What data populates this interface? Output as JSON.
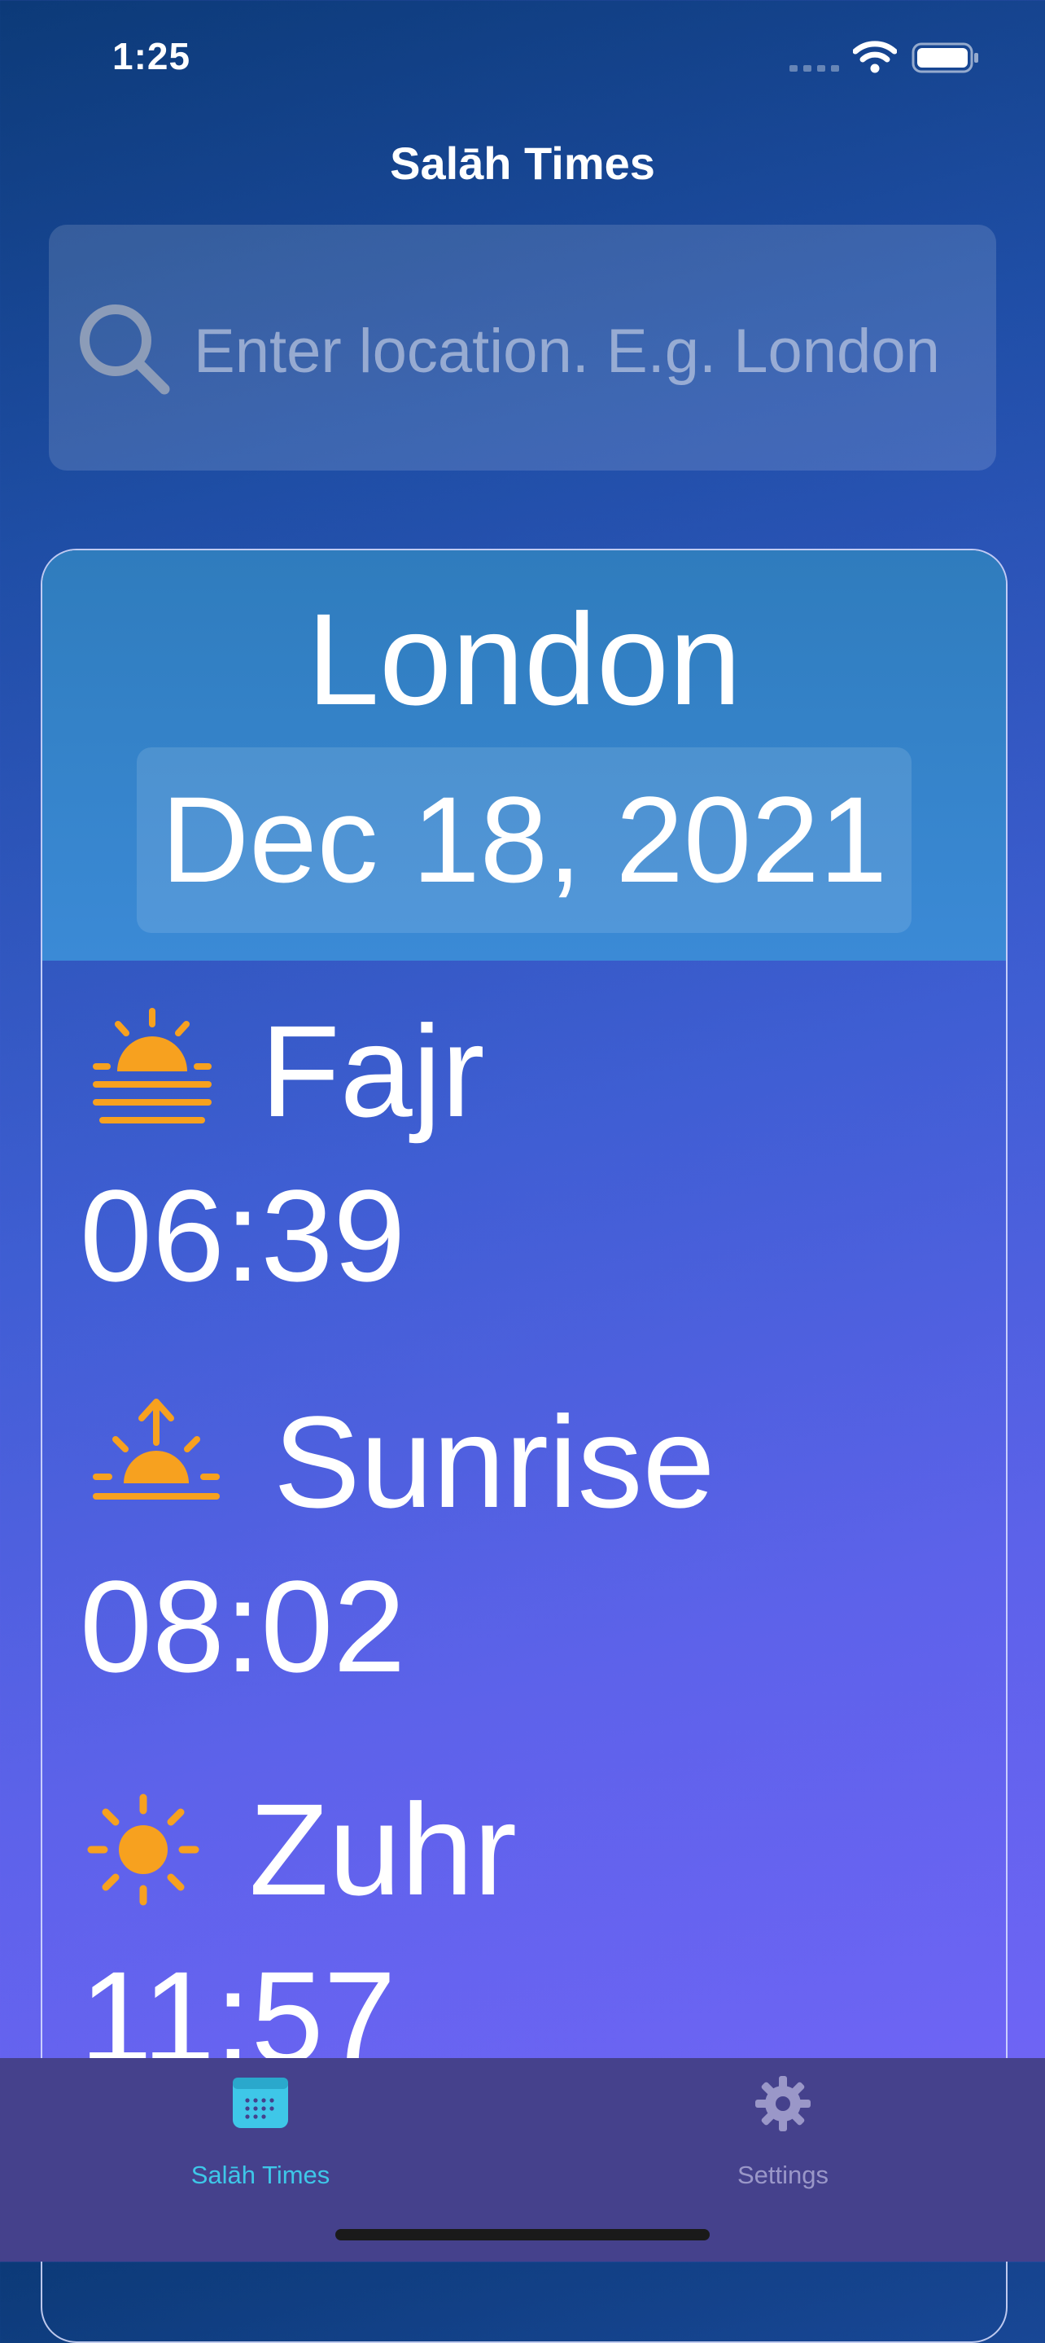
{
  "status_bar": {
    "time": "1:25",
    "signal_icon": "cellular-signal-icon",
    "wifi_icon": "wifi-icon",
    "battery_icon": "battery-icon"
  },
  "nav": {
    "title": "Salāh Times"
  },
  "search": {
    "placeholder": "Enter location. E.g. London",
    "value": "",
    "icon": "search-icon"
  },
  "location": {
    "city": "London",
    "date": "Dec 18, 2021"
  },
  "prayers": [
    {
      "name": "Fajr",
      "time": "06:39",
      "icon": "sunrise-horizon-icon"
    },
    {
      "name": "Sunrise",
      "time": "08:02",
      "icon": "sunrise-arrow-icon"
    },
    {
      "name": "Zuhr",
      "time": "11:57",
      "icon": "sun-icon"
    }
  ],
  "tabs": [
    {
      "label": "Salāh Times",
      "icon": "calendar-icon",
      "selected": true
    },
    {
      "label": "Settings",
      "icon": "gear-icon",
      "selected": false
    }
  ],
  "colors": {
    "accent_icon": "#f7a11f",
    "tab_selected": "#3ec7e8",
    "tab_unselected": "#9a97c8",
    "tab_bar": "#45418c"
  }
}
